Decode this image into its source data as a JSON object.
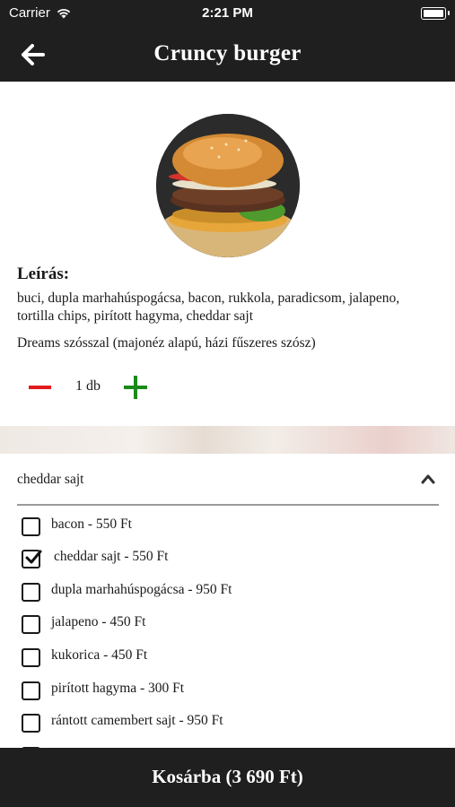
{
  "status_bar": {
    "carrier": "Carrier",
    "time": "2:21 PM"
  },
  "nav": {
    "title": "Cruncy burger",
    "back_icon": "arrow-left-icon"
  },
  "product": {
    "image": "burger-photo",
    "description_heading": "Leírás:",
    "description": "buci, dupla marhahúspogácsa, bacon, rukkola, paradicsom, jalapeno, tortilla chips, pirított hagyma, cheddar sajt",
    "sauce_note": "Dreams szósszal (majonéz alapú, házi fűszeres szósz)",
    "quantity_text": "1 db"
  },
  "extras": {
    "selected_summary": "cheddar sajt",
    "options": [
      {
        "label": "bacon - 550 Ft",
        "checked": false
      },
      {
        "label": "cheddar sajt - 550 Ft",
        "checked": true
      },
      {
        "label": "dupla marhahúspogácsa - 950 Ft",
        "checked": false
      },
      {
        "label": "jalapeno - 450 Ft",
        "checked": false
      },
      {
        "label": "kukorica - 450 Ft",
        "checked": false
      },
      {
        "label": "pirított hagyma - 300 Ft",
        "checked": false
      },
      {
        "label": "rántott camembert sajt - 950 Ft",
        "checked": false
      }
    ]
  },
  "footer": {
    "cart_button": "Kosárba (3 690 Ft)"
  },
  "colors": {
    "bar": "#1f1f1f",
    "minus": "#e21b1b",
    "plus": "#1a8a1a"
  }
}
